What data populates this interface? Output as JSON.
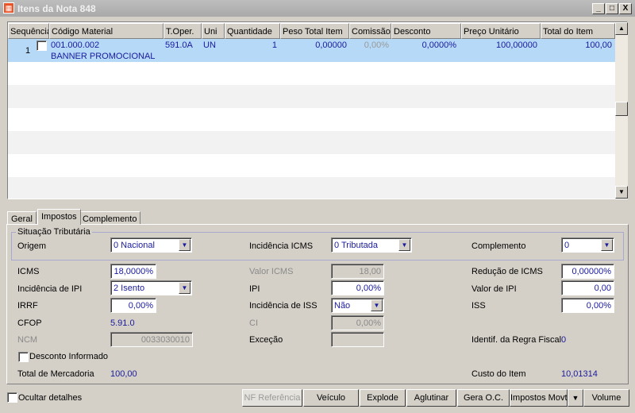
{
  "window": {
    "title": "Itens da Nota 848",
    "controls": [
      "_",
      "□",
      "X"
    ]
  },
  "grid": {
    "columns": [
      "Sequência",
      "Código Material",
      "T.Oper.",
      "Uni",
      "Quantidade",
      "Peso Total Item",
      "Comissão",
      "Desconto",
      "Preço Unitário",
      "Total do Item"
    ],
    "rows": [
      {
        "seq": "1",
        "codigo": "001.000.002",
        "descricao": "BANNER PROMOCIONAL",
        "toper": "591.0A",
        "uni": "UN",
        "quantidade": "1",
        "peso": "0,00000",
        "comissao": "0,00%",
        "desconto": "0,0000%",
        "preco": "100,00000",
        "total": "100,00",
        "checked": false
      }
    ],
    "selected_row_color": "#b5d9f7"
  },
  "tabs": [
    {
      "label": "Geral"
    },
    {
      "label": "Impostos",
      "active": true
    },
    {
      "label": "Complemento"
    }
  ],
  "impostos": {
    "group_title": "Situação Tributária",
    "origem": {
      "label": "Origem",
      "value": "0 Nacional"
    },
    "incidencia_icms": {
      "label": "Incidência ICMS",
      "value": "0 Tributada"
    },
    "complemento": {
      "label": "Complemento",
      "value": "0"
    },
    "icms": {
      "label": "ICMS",
      "value": "18,0000%"
    },
    "valor_icms": {
      "label": "Valor ICMS",
      "value": "18,00"
    },
    "reducao_icms": {
      "label": "Redução de ICMS",
      "value": "0,00000%"
    },
    "incidencia_ipi": {
      "label": "Incidência de IPI",
      "value": "2 Isento"
    },
    "ipi": {
      "label": "IPI",
      "value": "0,00%"
    },
    "valor_ipi": {
      "label": "Valor de IPI",
      "value": "0,00"
    },
    "irrf": {
      "label": "IRRF",
      "value": "0,00%"
    },
    "incidencia_iss": {
      "label": "Incidência de ISS",
      "value": "Não"
    },
    "iss": {
      "label": "ISS",
      "value": "0,00%"
    },
    "cfop": {
      "label": "CFOP",
      "value": "5.91.0"
    },
    "ci": {
      "label": "CI",
      "value": "0,00%"
    },
    "ncm": {
      "label": "NCM",
      "value": "0033030010"
    },
    "excecao": {
      "label": "Exceção",
      "value": ""
    },
    "regra_fiscal": {
      "label": "Identif. da Regra Fiscal",
      "value": "0"
    },
    "desconto_informado": {
      "label": "Desconto Informado",
      "checked": false
    },
    "total_mercadoria": {
      "label": "Total de Mercadoria",
      "value": "100,00"
    },
    "custo_item": {
      "label": "Custo do Item",
      "value": "10,01314"
    }
  },
  "footer": {
    "ocultar": {
      "label": "Ocultar detalhes",
      "checked": false
    },
    "buttons": [
      "NF Referência",
      "Veículo",
      "Explode",
      "Aglutinar",
      "Gera O.C.",
      "Impostos Movto",
      "Volume"
    ],
    "dropdown_icon": "caret-down-icon"
  }
}
